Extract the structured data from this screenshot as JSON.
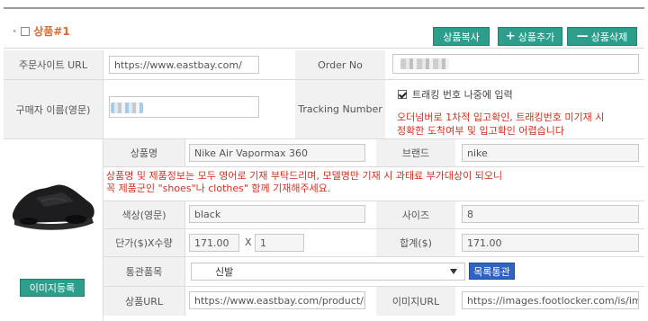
{
  "header": {
    "title": "상품#1",
    "buttons": {
      "copy": "상품복사",
      "add": "상품추가",
      "delete": "상품삭제"
    }
  },
  "order": {
    "site_url_label": "주문사이트 URL",
    "site_url_value": "https://www.eastbay.com/",
    "order_no_label": "Order No",
    "buyer_name_label": "구매자 이름(영문)",
    "tracking_label": "Tracking Number",
    "tracking_later_checkbox_label": "트래킹 번호 나중에 입력",
    "tracking_notice_line1": "오더넘버로 1차적 입고확인, 트래킹번호 미기재 시",
    "tracking_notice_line2": "정확한 도착여부 및 입고확인 어렵습니다"
  },
  "product": {
    "name_label": "상품명",
    "name_value": "Nike Air Vapormax 360",
    "brand_label": "브랜드",
    "brand_value": "nike",
    "notice_line1": "상품명 및 제품정보는 모두 영어로 기재 부탁드리며, 모델명만 기재 시 과태료 부가대상이 되오니",
    "notice_line2": "꼭 제품군인 \"shoes\"나 clothes\" 함께 기재해주세요.",
    "color_label": "색상(영문)",
    "color_value": "black",
    "size_label": "사이즈",
    "size_value": "8",
    "price_qty_label": "단가($)X수량",
    "price_value": "171.00",
    "times_symbol": "X",
    "qty_value": "1",
    "total_label": "합계($)",
    "total_value": "171.00",
    "customs_label": "통관품목",
    "customs_value": "신발",
    "customs_list_button": "목록통관",
    "url_label": "상품URL",
    "url_value": "https://www.eastbay.com/product/ni",
    "image_url_label": "이미지URL",
    "image_url_value": "https://images.footlocker.com/is/ima",
    "image_register_button": "이미지등록"
  },
  "colors": {
    "accent_green": "#2e9e8c",
    "accent_blue": "#2f63c4",
    "notice_red": "#d0301f",
    "title_orange": "#e2692c"
  }
}
